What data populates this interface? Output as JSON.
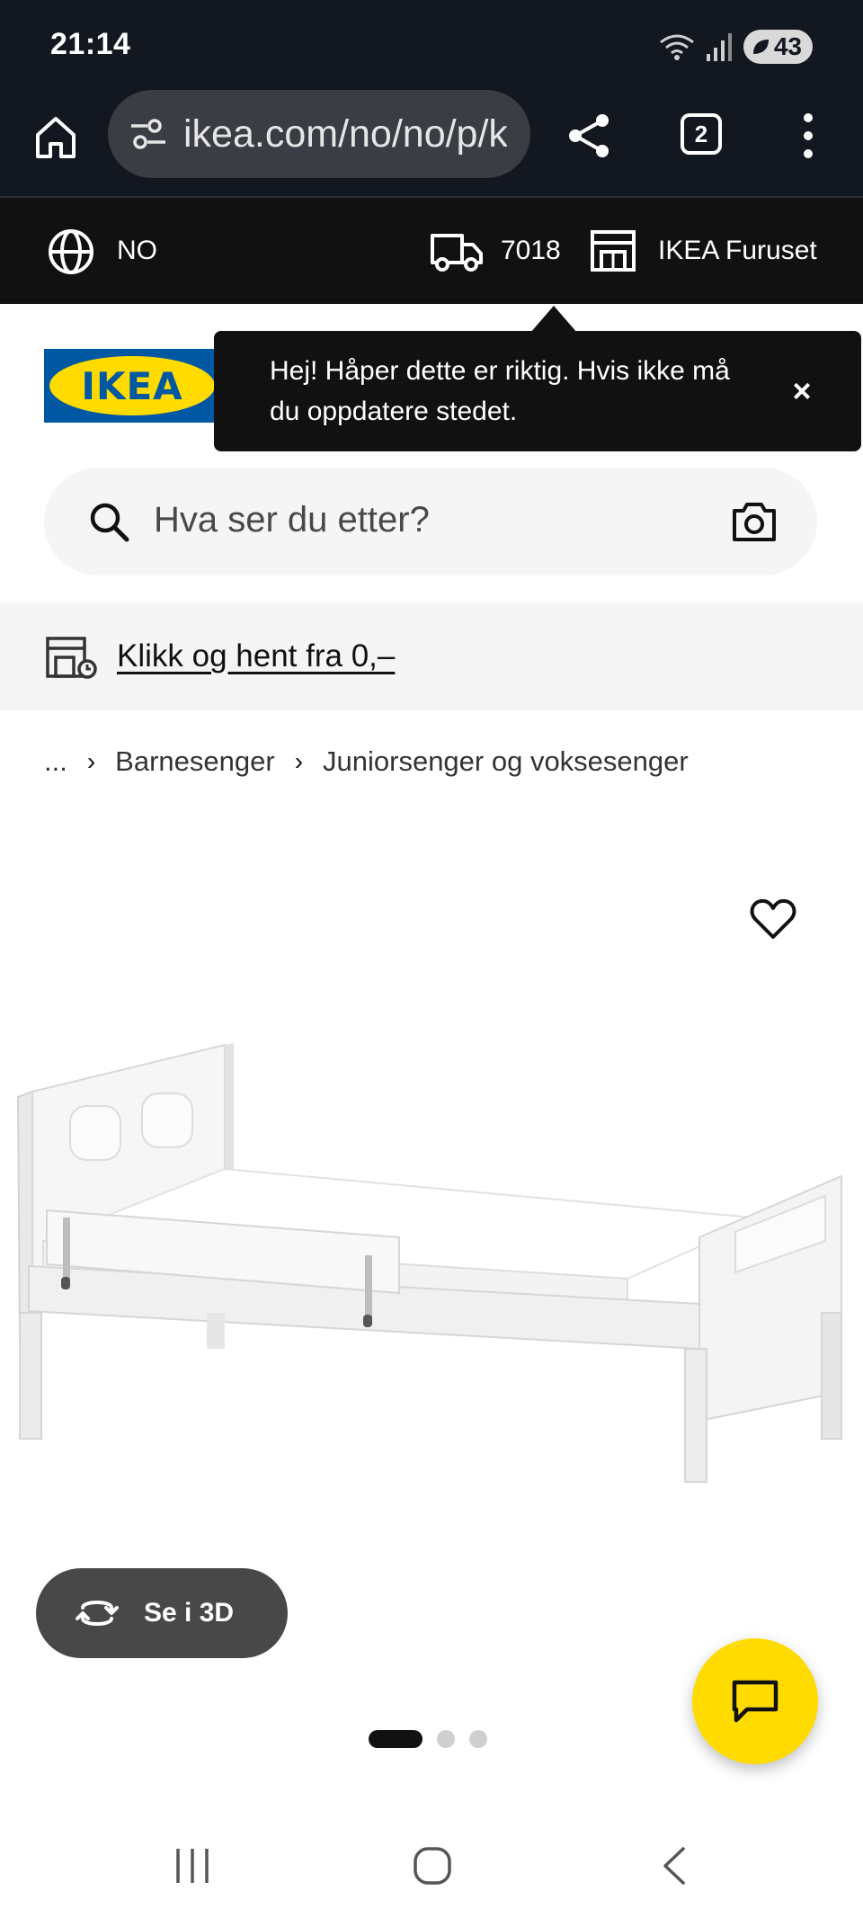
{
  "status_bar": {
    "time": "21:14",
    "battery": "43"
  },
  "browser": {
    "url": "ikea.com/no/no/p/k",
    "tab_count": "2"
  },
  "location_bar": {
    "country": "NO",
    "postcode": "7018",
    "store": "IKEA Furuset"
  },
  "logo": {
    "text": "IKEA"
  },
  "tooltip": {
    "message": "Hej! Håper dette er riktig. Hvis ikke må du oppdatere stedet.",
    "close": "×"
  },
  "search": {
    "placeholder": "Hva ser du etter?"
  },
  "click_collect": {
    "label": "Klikk og hent fra 0,–"
  },
  "breadcrumb": {
    "ellipsis": "...",
    "items": [
      "Barnesenger",
      "Juniorsenger og voksesenger"
    ]
  },
  "product": {
    "view_3d_label": "Se i 3D",
    "image_count": 3,
    "active_image": 1
  },
  "colors": {
    "ikea_blue": "#0058a3",
    "ikea_yellow": "#ffdb00",
    "dark": "#111111"
  },
  "icons": [
    "home-icon",
    "site-settings-icon",
    "share-icon",
    "more-icon",
    "globe-icon",
    "truck-icon",
    "store-icon",
    "search-icon",
    "camera-icon",
    "pickup-icon",
    "heart-icon",
    "rotate-3d-icon",
    "chat-icon",
    "recents-icon",
    "home-circle-icon",
    "back-icon"
  ]
}
